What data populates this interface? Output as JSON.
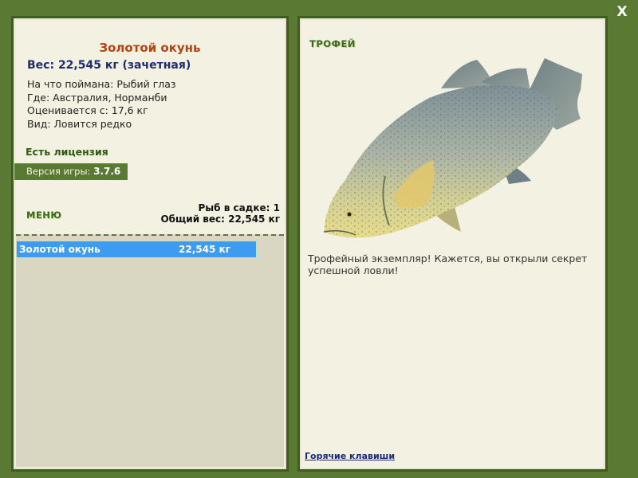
{
  "window": {
    "close_label": "X"
  },
  "fish": {
    "title": "Золотой окунь",
    "weight_line": "Вес: 22,545 кг (зачетная)",
    "info": [
      "На что поймана: Рыбий глаз",
      "Где: Австралия, Норманби",
      "Оценивается с: 17,6 кг",
      "Вид: Ловится редко"
    ]
  },
  "license": "Есть лицензия",
  "version": {
    "label": "Версия игры: ",
    "number": "3.7.6"
  },
  "menu_label": "МЕНЮ",
  "keepnet": {
    "count_line": "Рыб в садке: 1",
    "total_line": "Общий вес: 22,545 кг",
    "rows": [
      {
        "name": "Золотой окунь",
        "weight": "22,545 кг"
      }
    ]
  },
  "trophy": {
    "label": "ТРОФЕЙ",
    "description": "Трофейный экземпляр! Кажется, вы открыли секрет успешной ловли!"
  },
  "hotkeys_label": "Горячие клавиши",
  "colors": {
    "background": "#5a7a34",
    "panel": "#f3f1e1",
    "title": "#b04513",
    "weight": "#1d2b73",
    "selected_row": "#3d9cf0"
  },
  "icons": {
    "close": "close-icon",
    "fish": "fish-image"
  }
}
